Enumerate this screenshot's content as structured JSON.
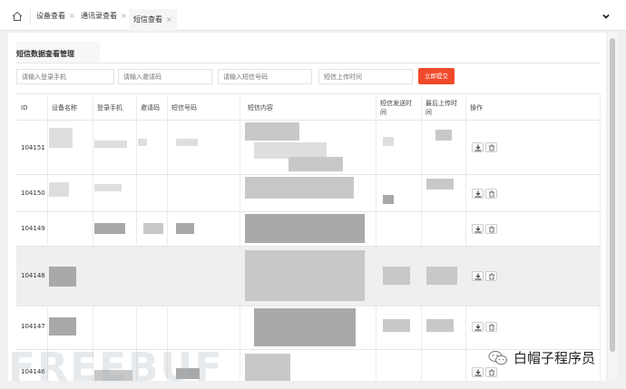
{
  "tabs": [
    {
      "label": "设备查看",
      "close": "×"
    },
    {
      "label": "通讯录查看",
      "close": "×"
    },
    {
      "label": "短信查看",
      "close": "×"
    }
  ],
  "panel": {
    "title": "短信数据查看管理"
  },
  "search": {
    "phone_placeholder": "请输入登录手机",
    "invite_placeholder": "请输入邀请码",
    "sms_number_placeholder": "请输入短信号码",
    "upload_time_placeholder": "短信上传时间",
    "submit_label": "立即提交"
  },
  "table": {
    "columns": [
      "ID",
      "设备名称",
      "登录手机",
      "邀请码",
      "短信号码",
      "短信内容",
      "短信发送时间",
      "最后上传时间",
      "操作"
    ],
    "rows": [
      {
        "id": "104151"
      },
      {
        "id": "104150"
      },
      {
        "id": "104149"
      },
      {
        "id": "104148"
      },
      {
        "id": "104147"
      },
      {
        "id": "104146"
      }
    ]
  },
  "watermark": "FREEBUF",
  "badge": {
    "text": "白帽子程序员",
    "icon": "wechat-icon"
  },
  "colors": {
    "accent": "#f14a2a"
  }
}
